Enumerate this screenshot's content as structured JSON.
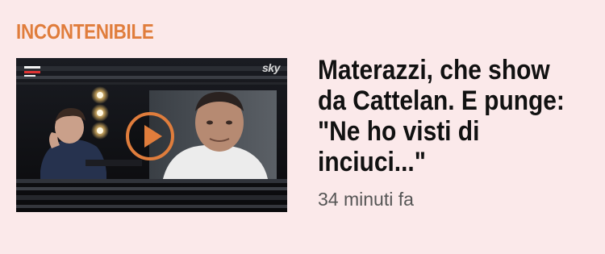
{
  "article": {
    "kicker": "INCONTENIBILE",
    "headline_lines": [
      "Materazzi, che show",
      "da Cattelan. E punge:",
      "\"Ne ho visti di",
      "inciuci...\""
    ],
    "timestamp": "34 minuti fa"
  },
  "thumbnail": {
    "channel_logo": "sky",
    "show_logo_icon": "epcc-show-logo-icon",
    "play_icon": "play-circle-icon"
  },
  "colors": {
    "background": "#fbe9ea",
    "kicker": "#e07d3c",
    "play_ring": "#e07d3c",
    "headline": "#111111",
    "timestamp": "#555555"
  }
}
